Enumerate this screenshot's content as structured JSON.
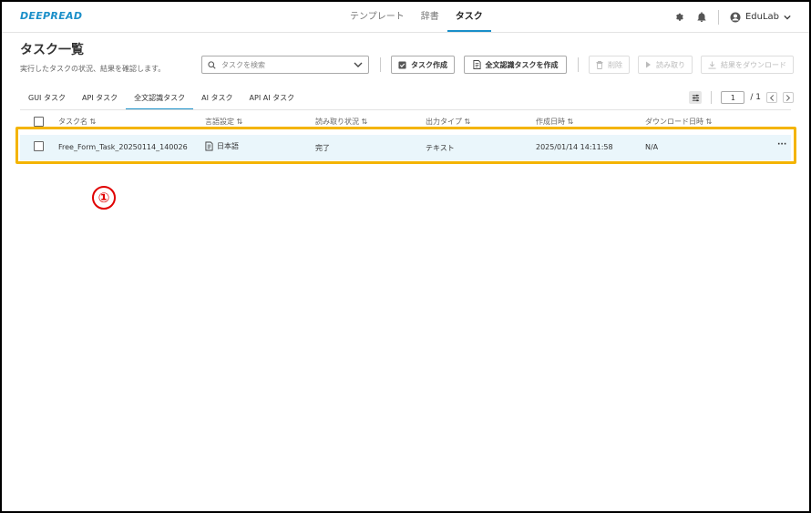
{
  "app": {
    "logo": "DEEPREAD"
  },
  "nav": {
    "items": [
      "テンプレート",
      "辞書",
      "タスク"
    ],
    "active": 2
  },
  "user": {
    "name": "EduLab"
  },
  "page": {
    "title": "タスク一覧",
    "subtitle": "実行したタスクの状況、結果を確認します。"
  },
  "search": {
    "placeholder": "タスクを検索"
  },
  "toolbar": {
    "create_task": "タスク作成",
    "create_fulltext_task": "全文認識タスクを作成",
    "delete": "削除",
    "read": "読み取り",
    "download": "結果をダウンロード"
  },
  "tabs": [
    "GUI タスク",
    "API タスク",
    "全文認識タスク",
    "AI タスク",
    "API AI タスク"
  ],
  "pager": {
    "current": "1",
    "total": "/ 1"
  },
  "table": {
    "headers": [
      "タスク名",
      "言語設定",
      "読み取り状況",
      "出力タイプ",
      "作成日時",
      "ダウンロード日時"
    ],
    "rows": [
      {
        "name": "Free_Form_Task_20250114_140026",
        "language": "日本語",
        "status": "完了",
        "output_type": "テキスト",
        "created": "2025/01/14 14:11:58",
        "downloaded": "N/A",
        "menu": "···"
      }
    ]
  },
  "annotation": {
    "marker": "①"
  },
  "colors": {
    "accent": "#1a8fc9",
    "highlight": "#f4b400",
    "marker": "#e00000",
    "row_bg": "#eaf6fb"
  }
}
